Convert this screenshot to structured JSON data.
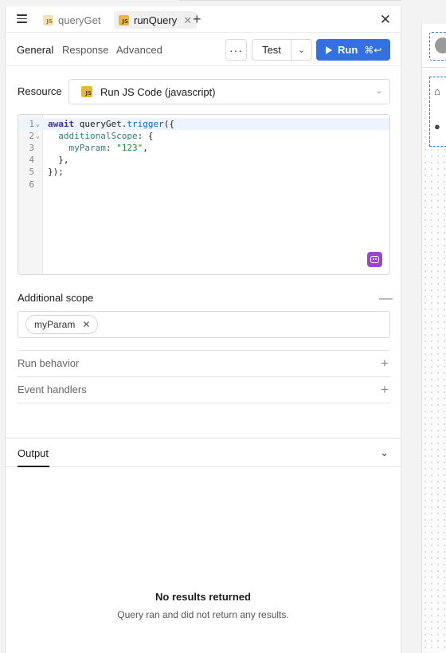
{
  "tabs": {
    "inactive": {
      "label": "queryGet",
      "badge": "JS"
    },
    "active": {
      "label": "runQuery",
      "badge": "JS"
    }
  },
  "subtabs": [
    "General",
    "Response",
    "Advanced"
  ],
  "toolbar": {
    "more_label": "···",
    "test_label": "Test",
    "run_label": "Run",
    "run_shortcut": "⌘↩"
  },
  "resource": {
    "label": "Resource",
    "value": "Run JS Code (javascript)",
    "badge": "JS"
  },
  "editor": {
    "line_numbers": [
      "1",
      "2",
      "3",
      "4",
      "5",
      "6"
    ],
    "code": {
      "l1_kw": "await",
      "l1_obj": " queryGet.",
      "l1_fn": "trigger",
      "l1_rest": "({",
      "l2_prop": "  additionalScope",
      "l2_rest": ": {",
      "l3_prop": "    myParam",
      "l3_mid": ": ",
      "l3_str": "\"123\"",
      "l3_rest": ",",
      "l4": "  },",
      "l5": "});",
      "l6": ""
    }
  },
  "additional_scope": {
    "label": "Additional scope",
    "chip": "myParam"
  },
  "run_behavior": {
    "label": "Run behavior"
  },
  "event_handlers": {
    "label": "Event handlers"
  },
  "output": {
    "tab_label": "Output",
    "empty_title": "No results returned",
    "empty_subtitle": "Query ran and did not return any results."
  }
}
